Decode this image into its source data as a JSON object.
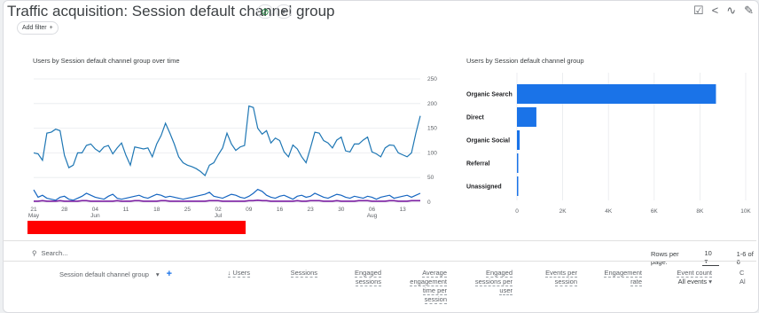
{
  "header": {
    "title": "Traffic acquisition: Session default channel group",
    "status_icon": "check-circle-icon",
    "dropdown_icon": "chevron-down-icon",
    "add_filter_label": "Add filter",
    "actions": [
      "customize-report-icon",
      "share-icon",
      "insights-icon",
      "edit-icon"
    ]
  },
  "line_panel": {
    "title": "Users by Session default channel group over time"
  },
  "bar_panel": {
    "title": "Users by Session default channel group"
  },
  "table": {
    "search_placeholder": "Search...",
    "rows_per_page_label": "Rows per page:",
    "rows_per_page_value": "10",
    "pagination": "1-6 of 6",
    "dimension_header": "Session default channel group",
    "columns": [
      {
        "label": "↓ Users"
      },
      {
        "label": "Sessions"
      },
      {
        "label": "Engaged sessions"
      },
      {
        "label": "Average engagement time per session"
      },
      {
        "label": "Engaged sessions per user"
      },
      {
        "label": "Events per session"
      },
      {
        "label": "Engagement rate"
      },
      {
        "label": "Event count",
        "sub": "All events"
      },
      {
        "label": "C",
        "sub": "Al"
      }
    ]
  },
  "chart_data": [
    {
      "type": "line",
      "x_ticks": [
        {
          "day": "21",
          "month": "May"
        },
        {
          "day": "28",
          "month": ""
        },
        {
          "day": "04",
          "month": "Jun"
        },
        {
          "day": "11",
          "month": ""
        },
        {
          "day": "18",
          "month": ""
        },
        {
          "day": "25",
          "month": ""
        },
        {
          "day": "02",
          "month": "Jul"
        },
        {
          "day": "09",
          "month": ""
        },
        {
          "day": "16",
          "month": ""
        },
        {
          "day": "23",
          "month": ""
        },
        {
          "day": "30",
          "month": ""
        },
        {
          "day": "06",
          "month": "Aug"
        },
        {
          "day": "13",
          "month": ""
        }
      ],
      "y_ticks": [
        "0",
        "50",
        "100",
        "150",
        "200",
        "250"
      ],
      "ylim": [
        0,
        250
      ],
      "x_range": [
        0,
        88
      ],
      "series": [
        {
          "color": "#1f77b4",
          "values": [
            100,
            98,
            85,
            140,
            142,
            148,
            145,
            95,
            70,
            75,
            100,
            100,
            115,
            118,
            108,
            102,
            112,
            115,
            98,
            110,
            120,
            95,
            75,
            112,
            110,
            108,
            110,
            92,
            118,
            135,
            160,
            140,
            118,
            92,
            80,
            75,
            72,
            68,
            62,
            54,
            75,
            80,
            96,
            110,
            140,
            118,
            105,
            112,
            115,
            195,
            192,
            150,
            138,
            145,
            120,
            130,
            125,
            102,
            92,
            116,
            108,
            92,
            80,
            110,
            142,
            140,
            125,
            120,
            110,
            126,
            132,
            104,
            102,
            118,
            118,
            126,
            132,
            102,
            98,
            92,
            110,
            116,
            115,
            100,
            96,
            92,
            100,
            140,
            175
          ]
        },
        {
          "color": "#1565c0",
          "values": [
            25,
            10,
            14,
            8,
            6,
            4,
            10,
            12,
            6,
            4,
            8,
            12,
            18,
            14,
            10,
            8,
            6,
            12,
            16,
            8,
            6,
            8,
            10,
            12,
            14,
            10,
            8,
            12,
            16,
            14,
            10,
            12,
            10,
            8,
            6,
            8,
            10,
            12,
            14,
            16,
            20,
            12,
            10,
            8,
            12,
            16,
            14,
            10,
            8,
            12,
            18,
            26,
            22,
            14,
            10,
            8,
            12,
            14,
            10,
            6,
            12,
            14,
            10,
            12,
            18,
            14,
            10,
            8,
            12,
            16,
            14,
            10,
            8,
            12,
            10,
            8,
            12,
            10,
            6,
            10,
            12,
            14,
            8,
            10,
            12,
            14,
            10,
            14,
            18
          ]
        },
        {
          "color": "#7b1fa2",
          "values": [
            2,
            2,
            3,
            2,
            2,
            2,
            3,
            2,
            2,
            2,
            2,
            3,
            3,
            2,
            2,
            2,
            2,
            2,
            2,
            3,
            2,
            2,
            2,
            3,
            3,
            2,
            2,
            2,
            2,
            3,
            3,
            2,
            2,
            2,
            2,
            2,
            2,
            2,
            2,
            2,
            3,
            3,
            3,
            2,
            2,
            2,
            2,
            2,
            2,
            3,
            3,
            4,
            3,
            3,
            2,
            2,
            2,
            2,
            2,
            2,
            3,
            2,
            2,
            3,
            3,
            3,
            2,
            2,
            2,
            3,
            2,
            2,
            2,
            2,
            3,
            3,
            3,
            2,
            2,
            2,
            2,
            3,
            3,
            2,
            2,
            2,
            3,
            3,
            3
          ]
        }
      ]
    },
    {
      "type": "bar",
      "orientation": "horizontal",
      "categories": [
        "Organic Search",
        "Direct",
        "Organic Social",
        "Referral",
        "Unassigned"
      ],
      "values": [
        8700,
        850,
        120,
        30,
        10
      ],
      "x_ticks": [
        "0",
        "2K",
        "4K",
        "6K",
        "8K",
        "10K"
      ],
      "xlim": [
        0,
        10000
      ],
      "color": "#1a73e8"
    }
  ]
}
